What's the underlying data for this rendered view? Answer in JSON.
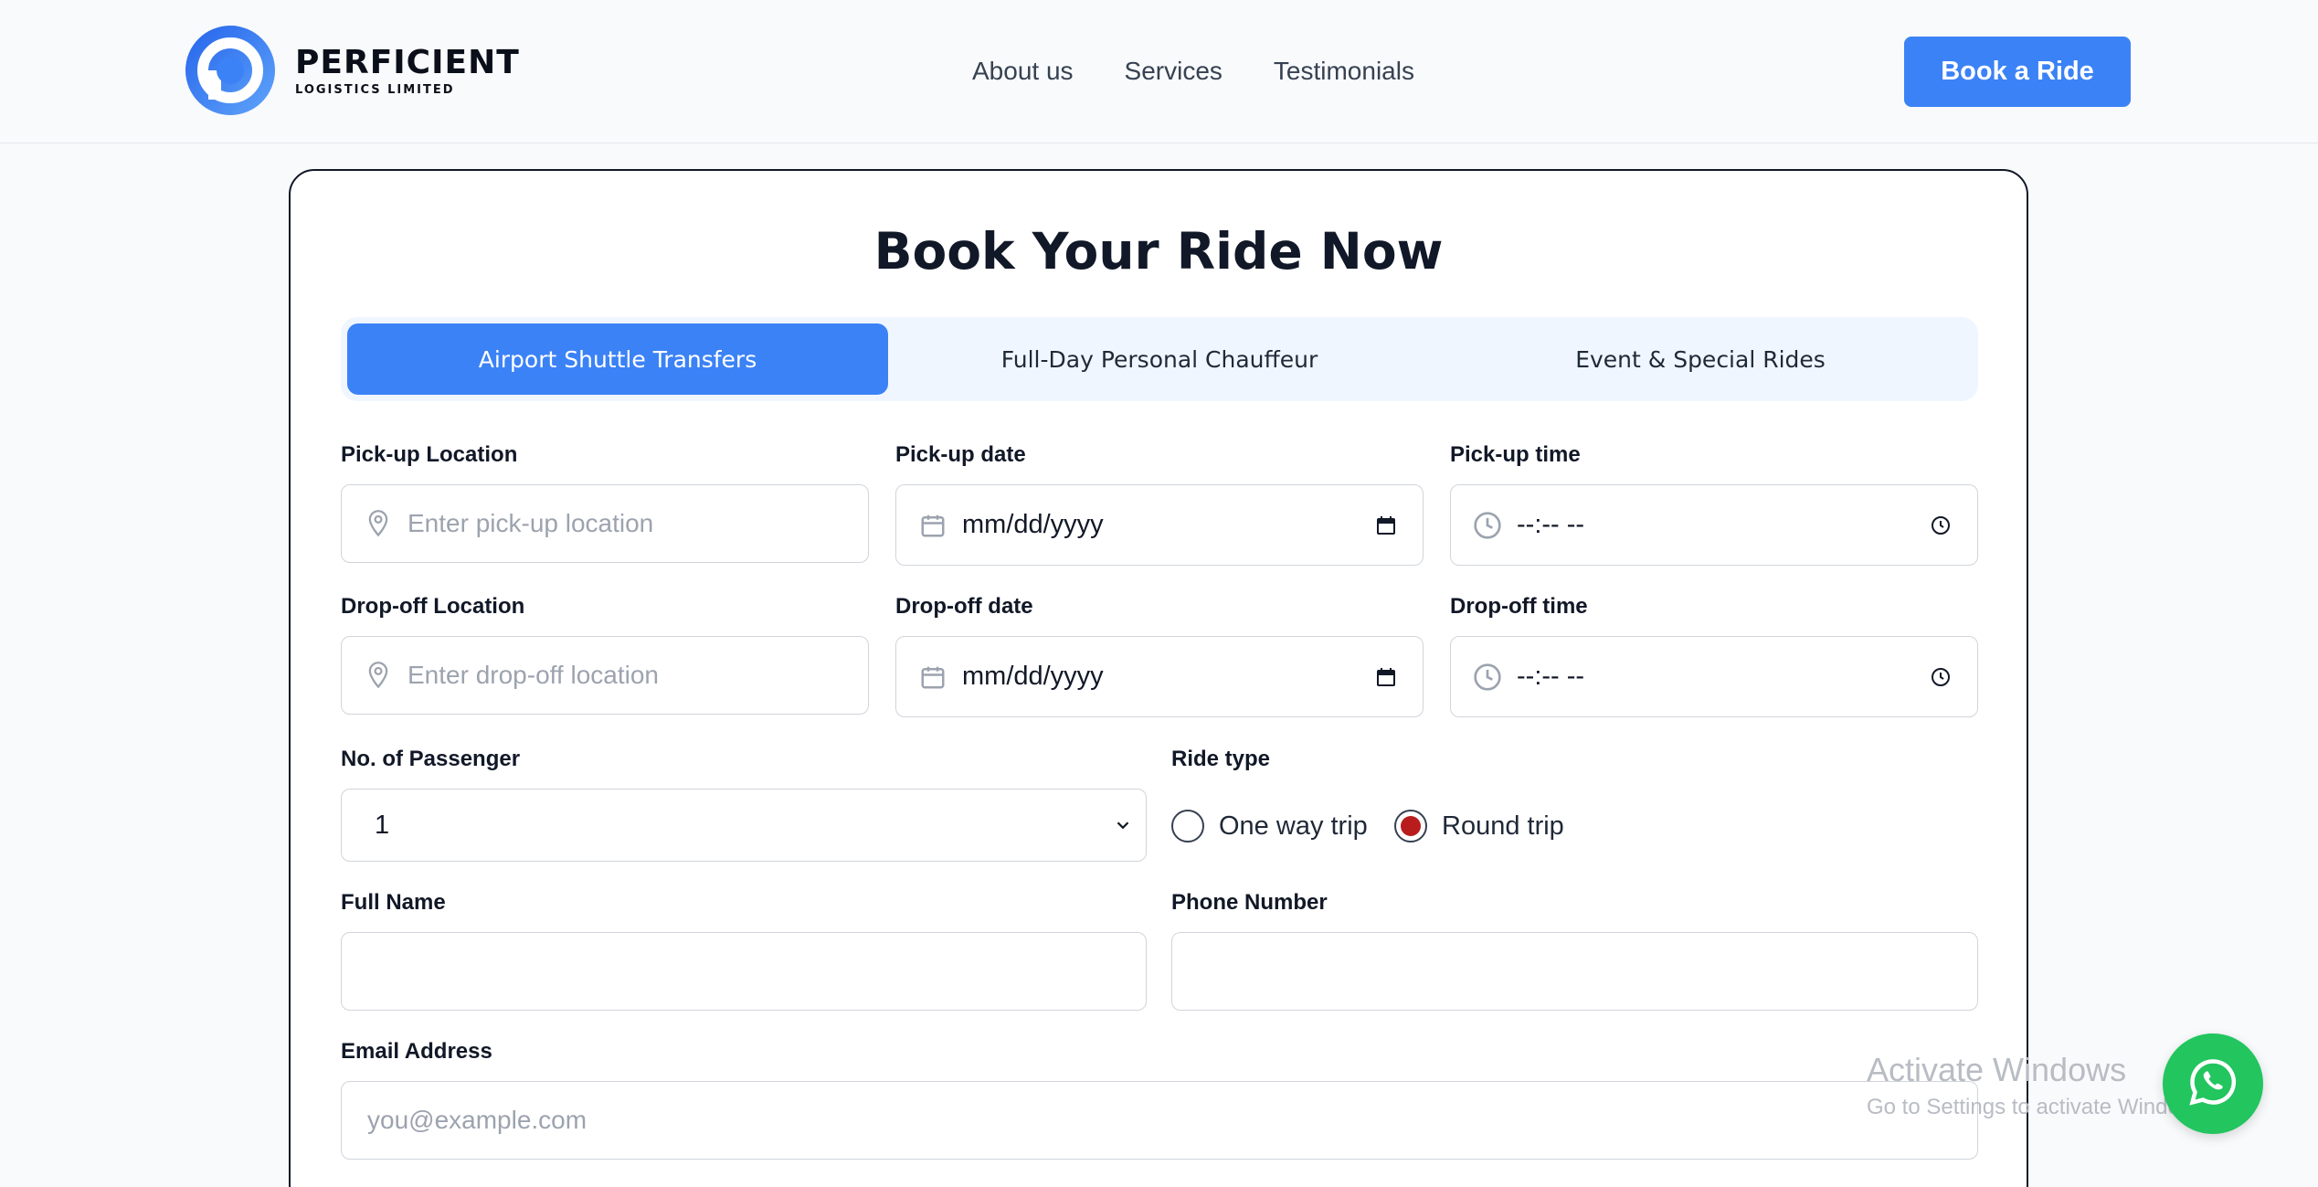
{
  "brand": {
    "title": "PERFICIENT",
    "subtitle": "LOGISTICS LIMITED",
    "accent_color": "#3b82f6"
  },
  "nav": {
    "items": [
      {
        "label": "About us"
      },
      {
        "label": "Services"
      },
      {
        "label": "Testimonials"
      }
    ],
    "cta_label": "Book a Ride"
  },
  "booking": {
    "title": "Book Your Ride Now",
    "tabs": [
      {
        "label": "Airport Shuttle Transfers",
        "active": true
      },
      {
        "label": "Full-Day Personal Chauffeur",
        "active": false
      },
      {
        "label": "Event & Special Rides",
        "active": false
      }
    ],
    "pickup_location": {
      "label": "Pick-up Location",
      "placeholder": "Enter pick-up location",
      "icon": "map-pin-icon"
    },
    "pickup_date": {
      "label": "Pick-up date",
      "value": "mm/dd/yyyy",
      "icon": "calendar-icon"
    },
    "pickup_time": {
      "label": "Pick-up time",
      "value": "--:-- --",
      "icon": "clock-icon"
    },
    "dropoff_location": {
      "label": "Drop-off Location",
      "placeholder": "Enter drop-off location",
      "icon": "map-pin-icon"
    },
    "dropoff_date": {
      "label": "Drop-off date",
      "value": "mm/dd/yyyy",
      "icon": "calendar-icon"
    },
    "dropoff_time": {
      "label": "Drop-off time",
      "value": "--:-- --",
      "icon": "clock-icon"
    },
    "passengers": {
      "label": "No. of Passenger",
      "value": "1"
    },
    "ride_type": {
      "label": "Ride type",
      "options": [
        {
          "label": "One way trip",
          "selected": false
        },
        {
          "label": "Round trip",
          "selected": true
        }
      ],
      "selected_color": "#b91c1c"
    },
    "full_name": {
      "label": "Full Name",
      "value": ""
    },
    "phone": {
      "label": "Phone Number",
      "value": ""
    },
    "email": {
      "label": "Email Address",
      "placeholder": "you@example.com"
    }
  },
  "watermark": {
    "line1": "Activate Windows",
    "line2": "Go to Settings to activate Windows."
  },
  "whatsapp": {
    "icon": "whatsapp-icon",
    "color": "#22c55e"
  }
}
